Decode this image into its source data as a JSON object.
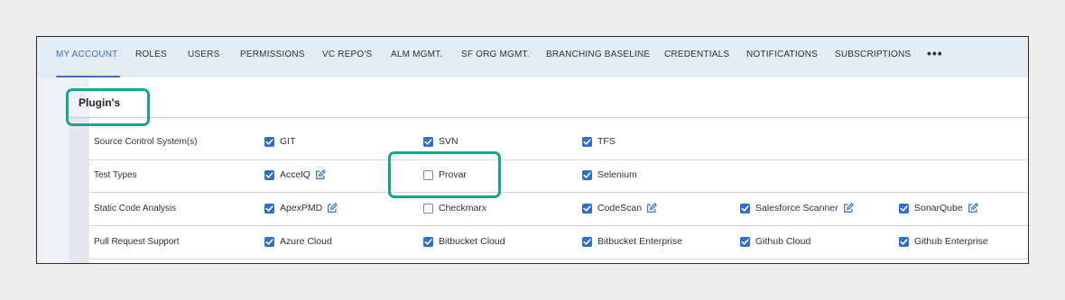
{
  "tabs": [
    {
      "label": "MY ACCOUNT",
      "active": true
    },
    {
      "label": "ROLES"
    },
    {
      "label": "USERS"
    },
    {
      "label": "PERMISSIONS"
    },
    {
      "label": "VC REPO'S"
    },
    {
      "label": "ALM MGMT."
    },
    {
      "label": "SF ORG MGMT."
    },
    {
      "label": "BRANCHING BASELINE"
    },
    {
      "label": "CREDENTIALS"
    },
    {
      "label": "NOTIFICATIONS"
    },
    {
      "label": "SUBSCRIPTIONS"
    },
    {
      "label": "•••"
    }
  ],
  "section": {
    "title": "Plugin's"
  },
  "rows": [
    {
      "label": "Source Control System(s)",
      "options": [
        {
          "label": "GIT",
          "checked": true,
          "editable": false
        },
        {
          "label": "SVN",
          "checked": true,
          "editable": false
        },
        {
          "label": "TFS",
          "checked": true,
          "editable": false
        }
      ]
    },
    {
      "label": "Test Types",
      "options": [
        {
          "label": "AccelQ",
          "checked": true,
          "editable": true
        },
        {
          "label": "Provar",
          "checked": false,
          "editable": false
        },
        {
          "label": "Selenium",
          "checked": true,
          "editable": false
        }
      ]
    },
    {
      "label": "Static Code Analysis",
      "options": [
        {
          "label": "ApexPMD",
          "checked": true,
          "editable": true
        },
        {
          "label": "Checkmarx",
          "checked": false,
          "editable": false
        },
        {
          "label": "CodeScan",
          "checked": true,
          "editable": true
        },
        {
          "label": "Salesforce Scanner",
          "checked": true,
          "editable": true
        },
        {
          "label": "SonarQube",
          "checked": true,
          "editable": true
        }
      ]
    },
    {
      "label": "Pull Request Support",
      "options": [
        {
          "label": "Azure Cloud",
          "checked": true,
          "editable": false
        },
        {
          "label": "Bitbucket Cloud",
          "checked": true,
          "editable": false
        },
        {
          "label": "Bitbucket Enterprise",
          "checked": true,
          "editable": false
        },
        {
          "label": "Github Cloud",
          "checked": true,
          "editable": false
        },
        {
          "label": "Github Enterprise",
          "checked": true,
          "editable": false
        }
      ]
    }
  ],
  "colors": {
    "accent": "#2f6fd4",
    "highlight": "#17a68c",
    "tab_bar": "#e3ebf4"
  },
  "icons": {
    "checked": "checkbox-checked-icon",
    "unchecked": "checkbox-unchecked-icon",
    "edit": "edit-icon"
  }
}
